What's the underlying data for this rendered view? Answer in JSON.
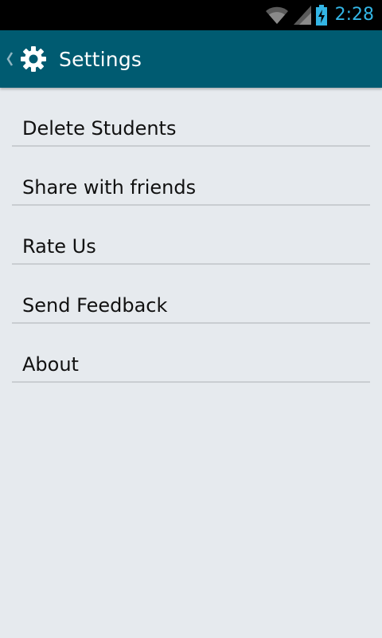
{
  "status_bar": {
    "time": "2:28",
    "icons": [
      "wifi-icon",
      "signal-icon",
      "battery-charging-icon"
    ],
    "time_color": "#33b5e5"
  },
  "action_bar": {
    "title": "Settings",
    "icon": "gear-icon",
    "up_icon": "chevron-left-icon",
    "color": "#005b71"
  },
  "settings": {
    "items": [
      {
        "label": "Delete Students"
      },
      {
        "label": "Share with friends"
      },
      {
        "label": "Rate Us"
      },
      {
        "label": "Send Feedback"
      },
      {
        "label": "About"
      }
    ]
  },
  "colors": {
    "background": "#e6eaee",
    "divider": "#c9cdd1",
    "text": "#111111"
  }
}
